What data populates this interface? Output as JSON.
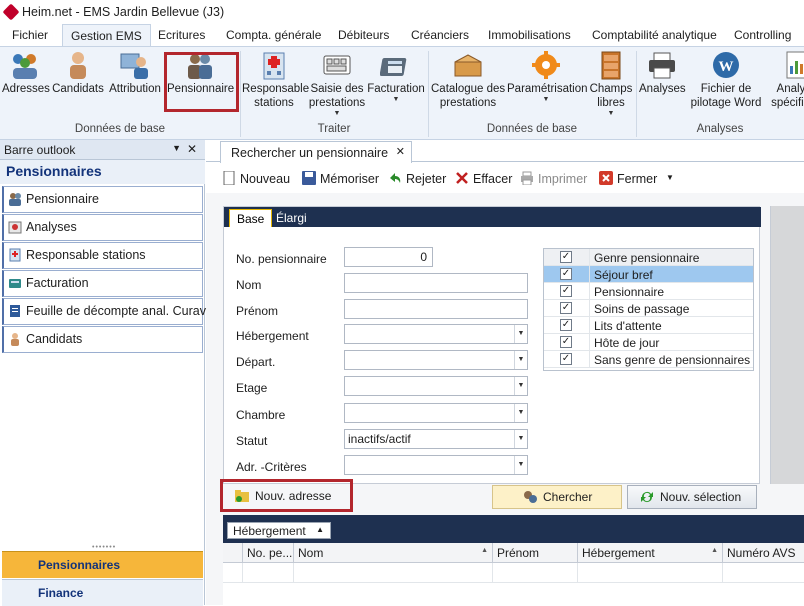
{
  "window": {
    "title": "Heim.net - EMS Jardin Bellevue (J3)"
  },
  "ribbon_tabs": [
    "Fichier",
    "Gestion EMS",
    "Ecritures",
    "Compta. générale",
    "Débiteurs",
    "Créanciers",
    "Immobilisations",
    "Comptabilité analytique",
    "Controlling"
  ],
  "ribbon": {
    "groups": [
      "Données de base",
      "Traiter",
      "Données de base",
      "Analyses"
    ],
    "buttons": {
      "adresses": "Adresses",
      "candidats": "Candidats",
      "attribution": "Attribution",
      "pensionnaire": "Pensionnaire",
      "responsable_line1": "Responsable",
      "responsable_line2": "stations",
      "saisie_line1": "Saisie des",
      "saisie_line2": "prestations",
      "facturation": "Facturation",
      "catalogue_line1": "Catalogue des",
      "catalogue_line2": "prestations",
      "parametrisation": "Paramétrisation",
      "champs_line1": "Champs",
      "champs_line2": "libres",
      "analyses": "Analyses",
      "fichier_line1": "Fichier de",
      "fichier_line2": "pilotage Word",
      "analyse_line1": "Analyse",
      "analyse_line2": "spécifique"
    }
  },
  "outlook": {
    "header": "Barre outlook",
    "section_title": "Pensionnaires",
    "items": [
      "Pensionnaire",
      "Analyses",
      "Responsable stations",
      "Facturation",
      "Feuille de décompte anal. Curavi",
      "Candidats"
    ],
    "bottom_buttons": [
      "Pensionnaires",
      "Finance"
    ]
  },
  "document_tab": {
    "label": "Rechercher un pensionnaire"
  },
  "toolbar": {
    "nouveau": "Nouveau",
    "memoriser": "Mémoriser",
    "rejeter": "Rejeter",
    "effacer": "Effacer",
    "imprimer": "Imprimer",
    "fermer": "Fermer"
  },
  "form": {
    "tabs": [
      "Base",
      "Élargi"
    ],
    "fields": [
      {
        "label": "No. pensionnaire",
        "value": "0"
      },
      {
        "label": "Nom",
        "value": ""
      },
      {
        "label": "Prénom",
        "value": ""
      },
      {
        "label": "Hébergement",
        "value": ""
      },
      {
        "label": "Départ.",
        "value": ""
      },
      {
        "label": "Etage",
        "value": ""
      },
      {
        "label": "Chambre",
        "value": ""
      },
      {
        "label": "Statut",
        "value": "inactifs/actif"
      },
      {
        "label": "Adr. -Critères",
        "value": ""
      }
    ],
    "checklist": {
      "header": "Genre pensionnaire",
      "items": [
        "Séjour bref",
        "Pensionnaire",
        "Soins de passage",
        "Lits d'attente",
        "Hôte de jour",
        "Sans genre de pensionnaires"
      ],
      "checked": true
    }
  },
  "buttons": {
    "nouv_adresse": "Nouv. adresse",
    "chercher": "Chercher",
    "nouv_selection": "Nouv. sélection"
  },
  "grid": {
    "group_by": "Hébergement",
    "columns": [
      "No. pe...",
      "Nom",
      "Prénom",
      "Hébergement",
      "Numéro AVS"
    ]
  },
  "colors": {
    "highlight_box": "#b3262d",
    "selected_row": "#9ec8ef",
    "dark_header": "#1e3050",
    "bottom_button": "#f6b63a"
  }
}
